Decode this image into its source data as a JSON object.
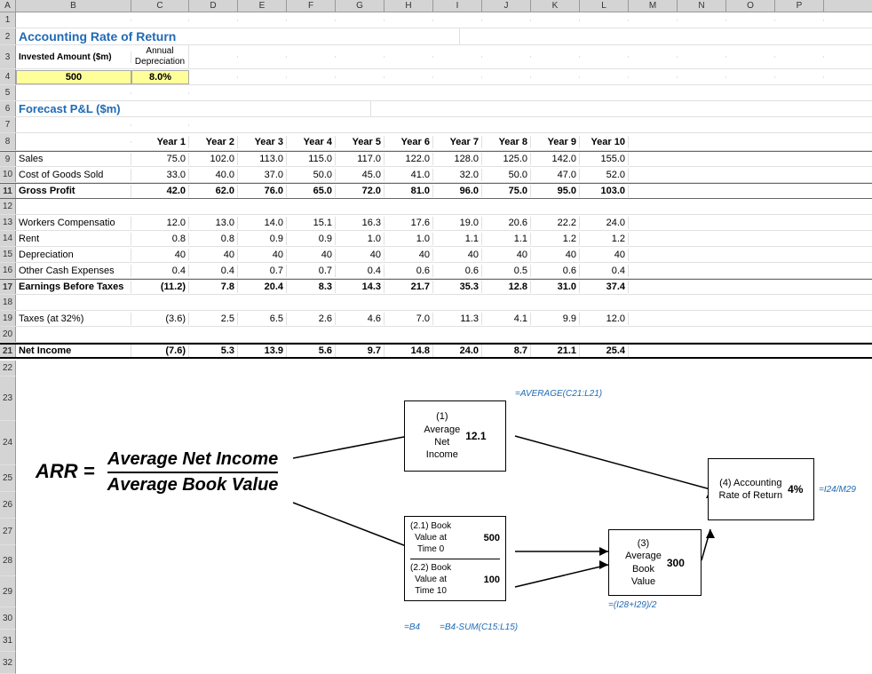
{
  "title": "Accounting Rate of Return",
  "subtitle": "Forecast P&L ($m)",
  "header": {
    "col_a": "A",
    "col_b": "B",
    "col_c": "C",
    "col_d": "D",
    "col_e": "E",
    "col_f": "F",
    "col_g": "G",
    "col_h": "H",
    "col_i": "I",
    "col_j": "J",
    "col_k": "K",
    "col_l": "L",
    "col_m": "M",
    "col_n": "N",
    "col_o": "O",
    "col_p": "P"
  },
  "inputs": {
    "invested_amount_label": "Invested Amount ($m)",
    "annual_dep_label": "Annual\nDepreciation",
    "invested_amount_value": "500",
    "dep_value": "8.0%"
  },
  "years": [
    "Year 1",
    "Year 2",
    "Year 3",
    "Year 4",
    "Year 5",
    "Year 6",
    "Year 7",
    "Year 8",
    "Year 9",
    "Year 10"
  ],
  "rows": {
    "sales": {
      "label": "Sales",
      "values": [
        "75.0",
        "102.0",
        "113.0",
        "115.0",
        "117.0",
        "122.0",
        "128.0",
        "125.0",
        "142.0",
        "155.0"
      ]
    },
    "cogs": {
      "label": "Cost of Goods Sold",
      "values": [
        "33.0",
        "40.0",
        "37.0",
        "50.0",
        "45.0",
        "41.0",
        "32.0",
        "50.0",
        "47.0",
        "52.0"
      ]
    },
    "gross_profit": {
      "label": "Gross Profit",
      "values": [
        "42.0",
        "62.0",
        "76.0",
        "65.0",
        "72.0",
        "81.0",
        "96.0",
        "75.0",
        "95.0",
        "103.0"
      ]
    },
    "workers_comp": {
      "label": "Workers Compensatio",
      "values": [
        "12.0",
        "13.0",
        "14.0",
        "15.1",
        "16.3",
        "17.6",
        "19.0",
        "20.6",
        "22.2",
        "24.0"
      ]
    },
    "rent": {
      "label": "Rent",
      "values": [
        "0.8",
        "0.8",
        "0.9",
        "0.9",
        "1.0",
        "1.0",
        "1.1",
        "1.1",
        "1.2",
        "1.2"
      ]
    },
    "depreciation": {
      "label": "Depreciation",
      "values": [
        "40",
        "40",
        "40",
        "40",
        "40",
        "40",
        "40",
        "40",
        "40",
        "40"
      ]
    },
    "other_cash": {
      "label": "Other Cash Expenses",
      "values": [
        "0.4",
        "0.4",
        "0.7",
        "0.7",
        "0.4",
        "0.6",
        "0.6",
        "0.5",
        "0.6",
        "0.4"
      ]
    },
    "ebt": {
      "label": "Earnings Before Taxes",
      "values": [
        "(11.2)",
        "7.8",
        "20.4",
        "8.3",
        "14.3",
        "21.7",
        "35.3",
        "12.8",
        "31.0",
        "37.4"
      ]
    },
    "taxes": {
      "label": "Taxes (at 32%)",
      "values": [
        "(3.6)",
        "2.5",
        "6.5",
        "2.6",
        "4.6",
        "7.0",
        "11.3",
        "4.1",
        "9.9",
        "12.0"
      ]
    },
    "net_income": {
      "label": "Net Income",
      "values": [
        "(7.6)",
        "5.3",
        "13.9",
        "5.6",
        "9.7",
        "14.8",
        "24.0",
        "8.7",
        "21.1",
        "25.4"
      ]
    }
  },
  "diagram": {
    "arr_label": "ARR =",
    "arr_num": "Average Net Income",
    "arr_den": "Average Book Value",
    "box1_label": "(1)\nAverage\nNet\nIncome",
    "box1_value": "12.1",
    "box21_label": "(2.1) Book\nValue at\nTime 0",
    "box21_value": "500",
    "box22_label": "(2.2) Book\nValue at\nTime 10",
    "box22_value": "100",
    "box3_label": "(3)\nAverage\nBook\nValue",
    "box3_value": "300",
    "box4_label": "(4) Accounting\nRate of Return",
    "box4_value": "4%",
    "formula1": "=AVERAGE(C21:L21)",
    "formula4": "=I24/M29",
    "formula21": "=B4",
    "formula22": "=B4-SUM(C15:L15)",
    "formula3": "=(I28+I29)/2"
  }
}
